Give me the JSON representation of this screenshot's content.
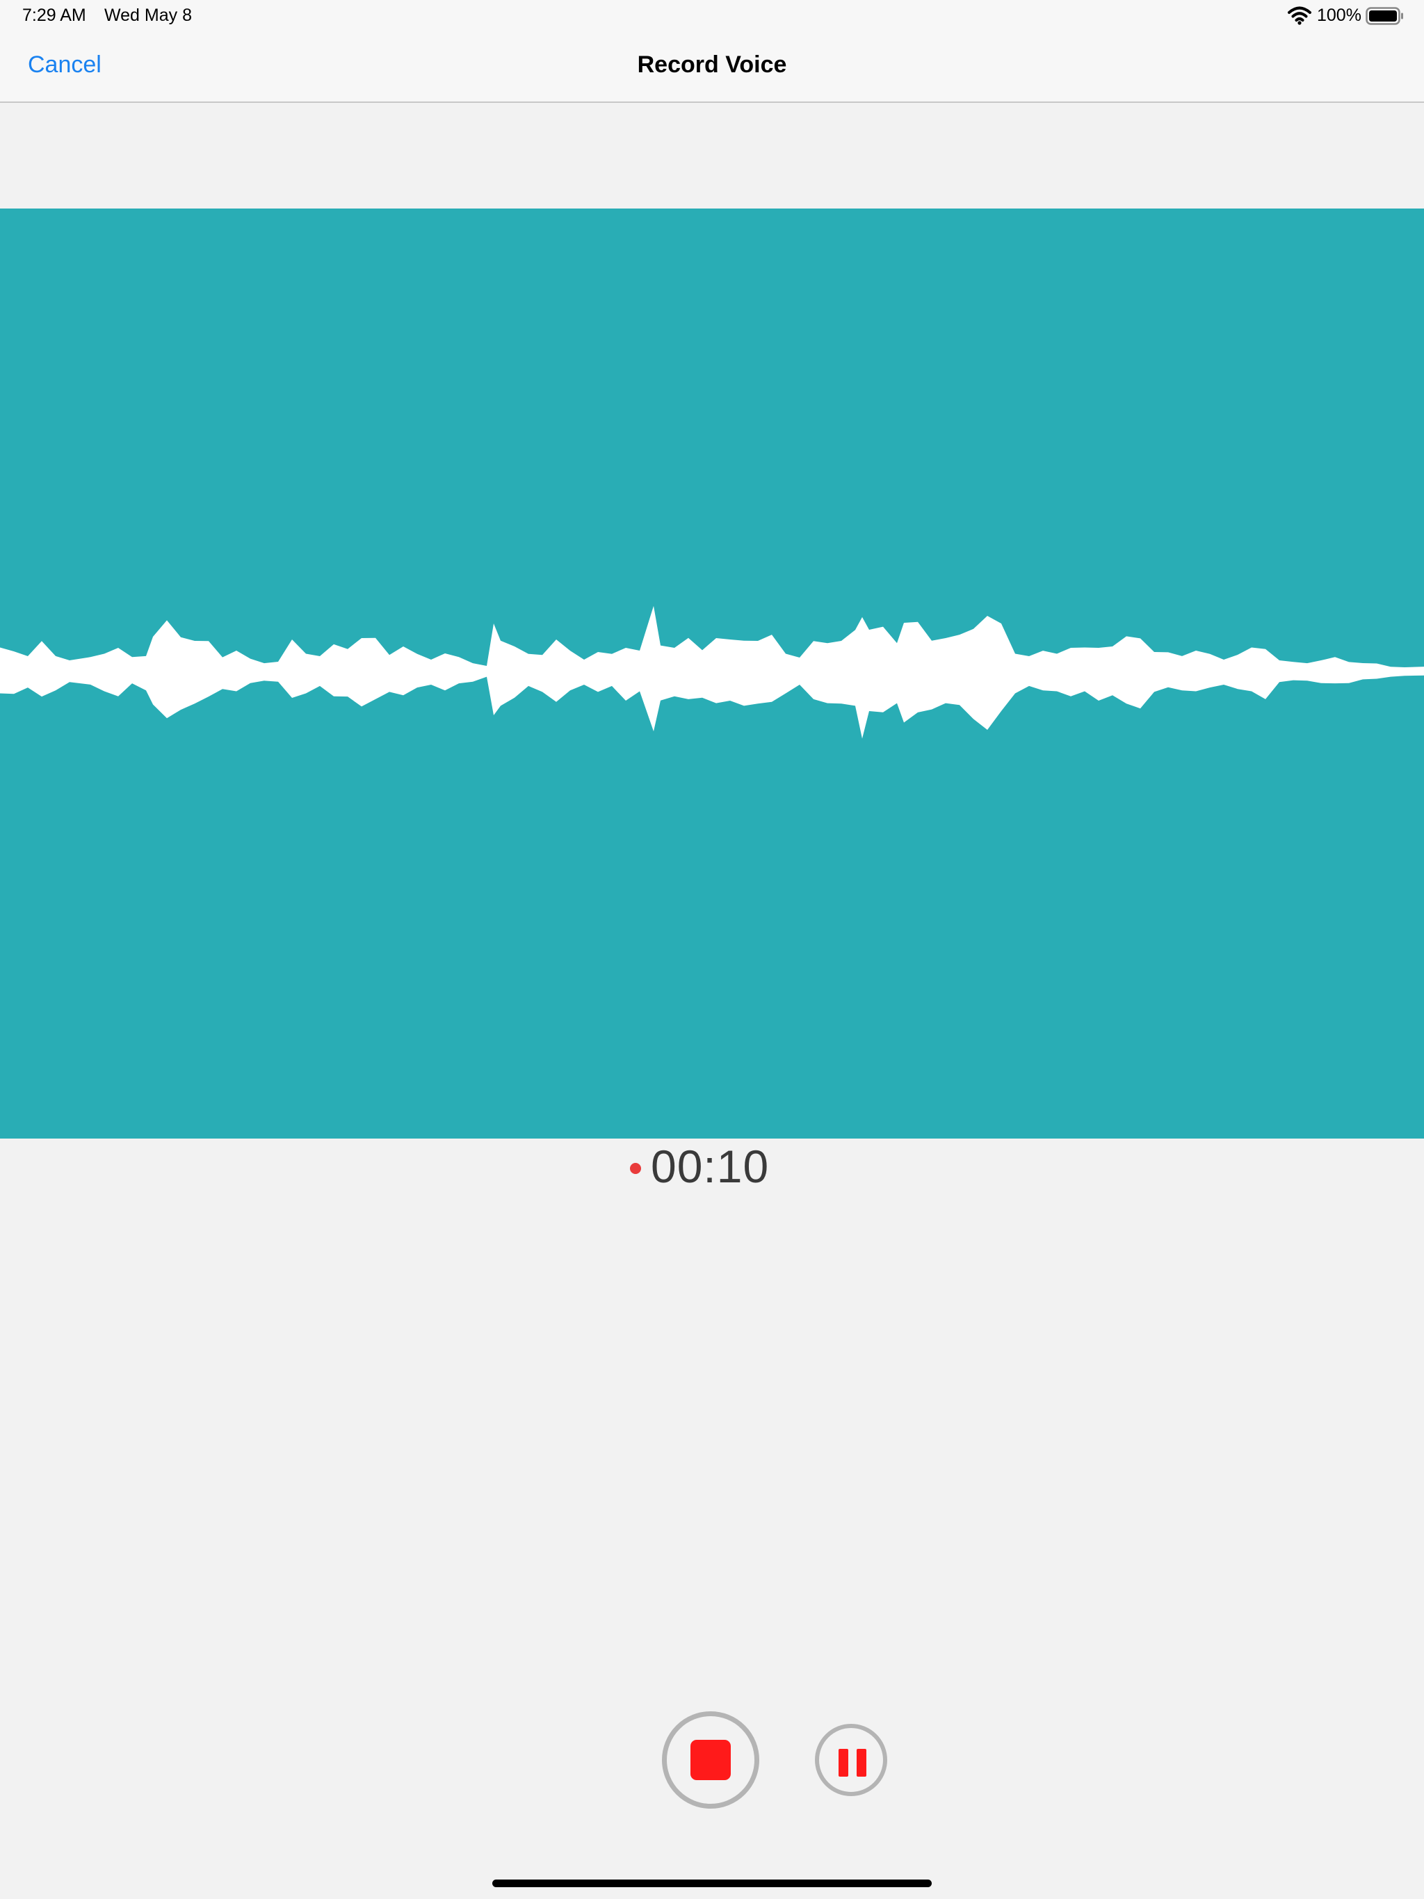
{
  "status_bar": {
    "time": "7:29 AM",
    "date": "Wed May 8",
    "battery": "100%"
  },
  "nav": {
    "cancel_label": "Cancel",
    "title": "Record Voice"
  },
  "recording": {
    "elapsed": "00:10"
  },
  "icons": {
    "wifi": "wifi-icon",
    "battery": "battery-icon",
    "recording_indicator": "record-dot-icon",
    "stop": "stop-icon",
    "pause": "pause-icon"
  },
  "colors": {
    "accent_link": "#1a82f0",
    "waveform_background": "#29adb5",
    "waveform_fill": "#ffffff",
    "record_red": "#ff1a1a",
    "recording_dot": "#e93b3b"
  }
}
